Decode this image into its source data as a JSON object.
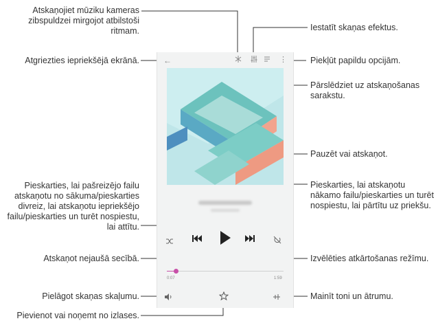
{
  "callouts": {
    "flash": "Atskaņojiet mūziku kameras zibspuldzei mirgojot atbilstoši ritmam.",
    "back": "Atgriezties iepriekšējā ekrānā.",
    "previous": "Pieskarties, lai pašreizējo failu atskaņotu no sākuma/pieskarties divreiz, lai atskaņotu iepriekšējo failu/pieskarties un turēt nospiestu, lai attītu.",
    "shuffle": "Atskaņot nejaušā secībā.",
    "volume": "Pielāgot skaņas skaļumu.",
    "favourite": "Pievienot vai noņemt no izlases.",
    "sound_effects": "Iestatīt skaņas efektus.",
    "more_options": "Piekļūt papildu opcijām.",
    "playlist": "Pārslēdziet uz atskaņošanas sarakstu.",
    "pause_play": "Pauzēt vai atskaņot.",
    "next": "Pieskarties, lai atskaņotu nākamo failu/pieskarties un turēt nospiestu, lai pārtītu uz priekšu.",
    "repeat": "Izvēlēties atkārtošanas režīmu.",
    "tone_speed": "Mainīt toni un ātrumu."
  },
  "player": {
    "elapsed": "0:07",
    "total": "1:59",
    "progress": 0.08
  },
  "icons": {
    "back": "back-arrow-icon",
    "flash": "flash-icon",
    "equalizer": "equalizer-icon",
    "playlist": "playlist-icon",
    "more": "more-vertical-icon",
    "previous": "skip-previous-icon",
    "play": "play-icon",
    "next": "skip-next-icon",
    "shuffle": "shuffle-icon",
    "repeat": "repeat-icon",
    "volume": "volume-icon",
    "favourite": "star-icon",
    "tone": "tone-speed-icon"
  },
  "colors": {
    "callout_line": "#333333",
    "art_background": "#bfe6e9",
    "art_teal": "#6cc2bd",
    "art_coral": "#f2a48e",
    "progress_accent": "#c850a8"
  }
}
